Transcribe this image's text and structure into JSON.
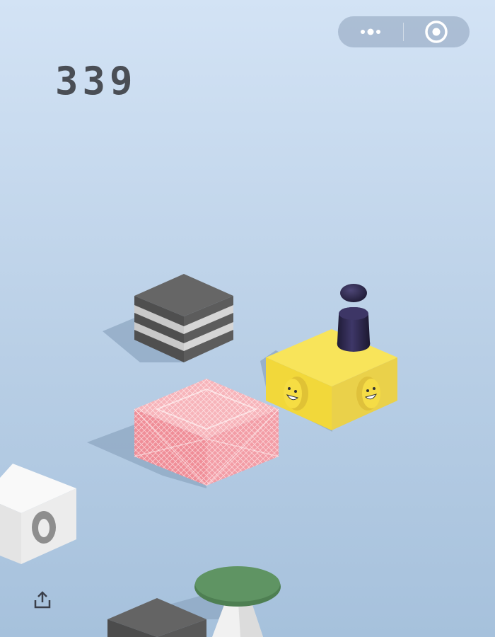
{
  "score": "339",
  "capsule": {
    "menu_icon": "more-dots-icon",
    "close_icon": "target-close-icon"
  },
  "share_icon": "share-upload-icon",
  "colors": {
    "background_top": "#d3e3f5",
    "background_bottom": "#a6c1dc",
    "score_text": "#4a4e55",
    "yellow_block": "#f5e24a",
    "pink_block": "#f4a6ae",
    "gray_block": "#606060",
    "white_block": "#f2f2f2",
    "green_disc": "#5b8e5e",
    "player": "#2d2848"
  }
}
